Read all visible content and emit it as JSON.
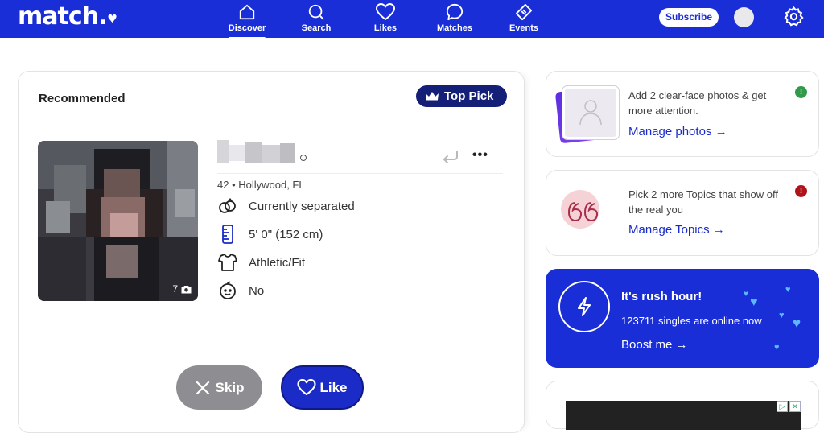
{
  "app": {
    "logo": "match.",
    "logo_heart": "♥"
  },
  "nav": {
    "items": [
      {
        "label": "Discover",
        "icon": "home-icon",
        "active": true
      },
      {
        "label": "Search",
        "icon": "search-icon"
      },
      {
        "label": "Likes",
        "icon": "heart-icon"
      },
      {
        "label": "Matches",
        "icon": "chat-icon"
      },
      {
        "label": "Events",
        "icon": "ticket-icon"
      }
    ],
    "subscribe_label": "Subscribe"
  },
  "profile_card": {
    "section_title": "Recommended",
    "badge": "Top Pick",
    "photo_count": "7",
    "age_location": "42 • Hollywood, FL",
    "attributes": [
      {
        "icon": "rings-icon",
        "text": "Currently separated"
      },
      {
        "icon": "ruler-icon",
        "text": "5' 0\" (152 cm)"
      },
      {
        "icon": "shirt-icon",
        "text": "Athletic/Fit"
      },
      {
        "icon": "baby-icon",
        "text": "No"
      }
    ],
    "skip_label": "Skip",
    "like_label": "Like"
  },
  "side_cards": {
    "photos": {
      "text": "Add 2 clear-face photos & get more attention.",
      "link": "Manage photos →",
      "badge": "!"
    },
    "topics": {
      "text": "Pick 2 more Topics that show off the real you",
      "link": "Manage Topics →",
      "badge": "!"
    },
    "rush": {
      "title": "It's rush hour!",
      "subtitle": "123711 singles are online now",
      "link": "Boost me →"
    }
  },
  "colors": {
    "brand_blue": "#1a2ed8",
    "top_pick_navy": "#142078",
    "skip_gray": "#8e8e92",
    "success_green": "#2e9a4a",
    "alert_red": "#b0141a"
  }
}
